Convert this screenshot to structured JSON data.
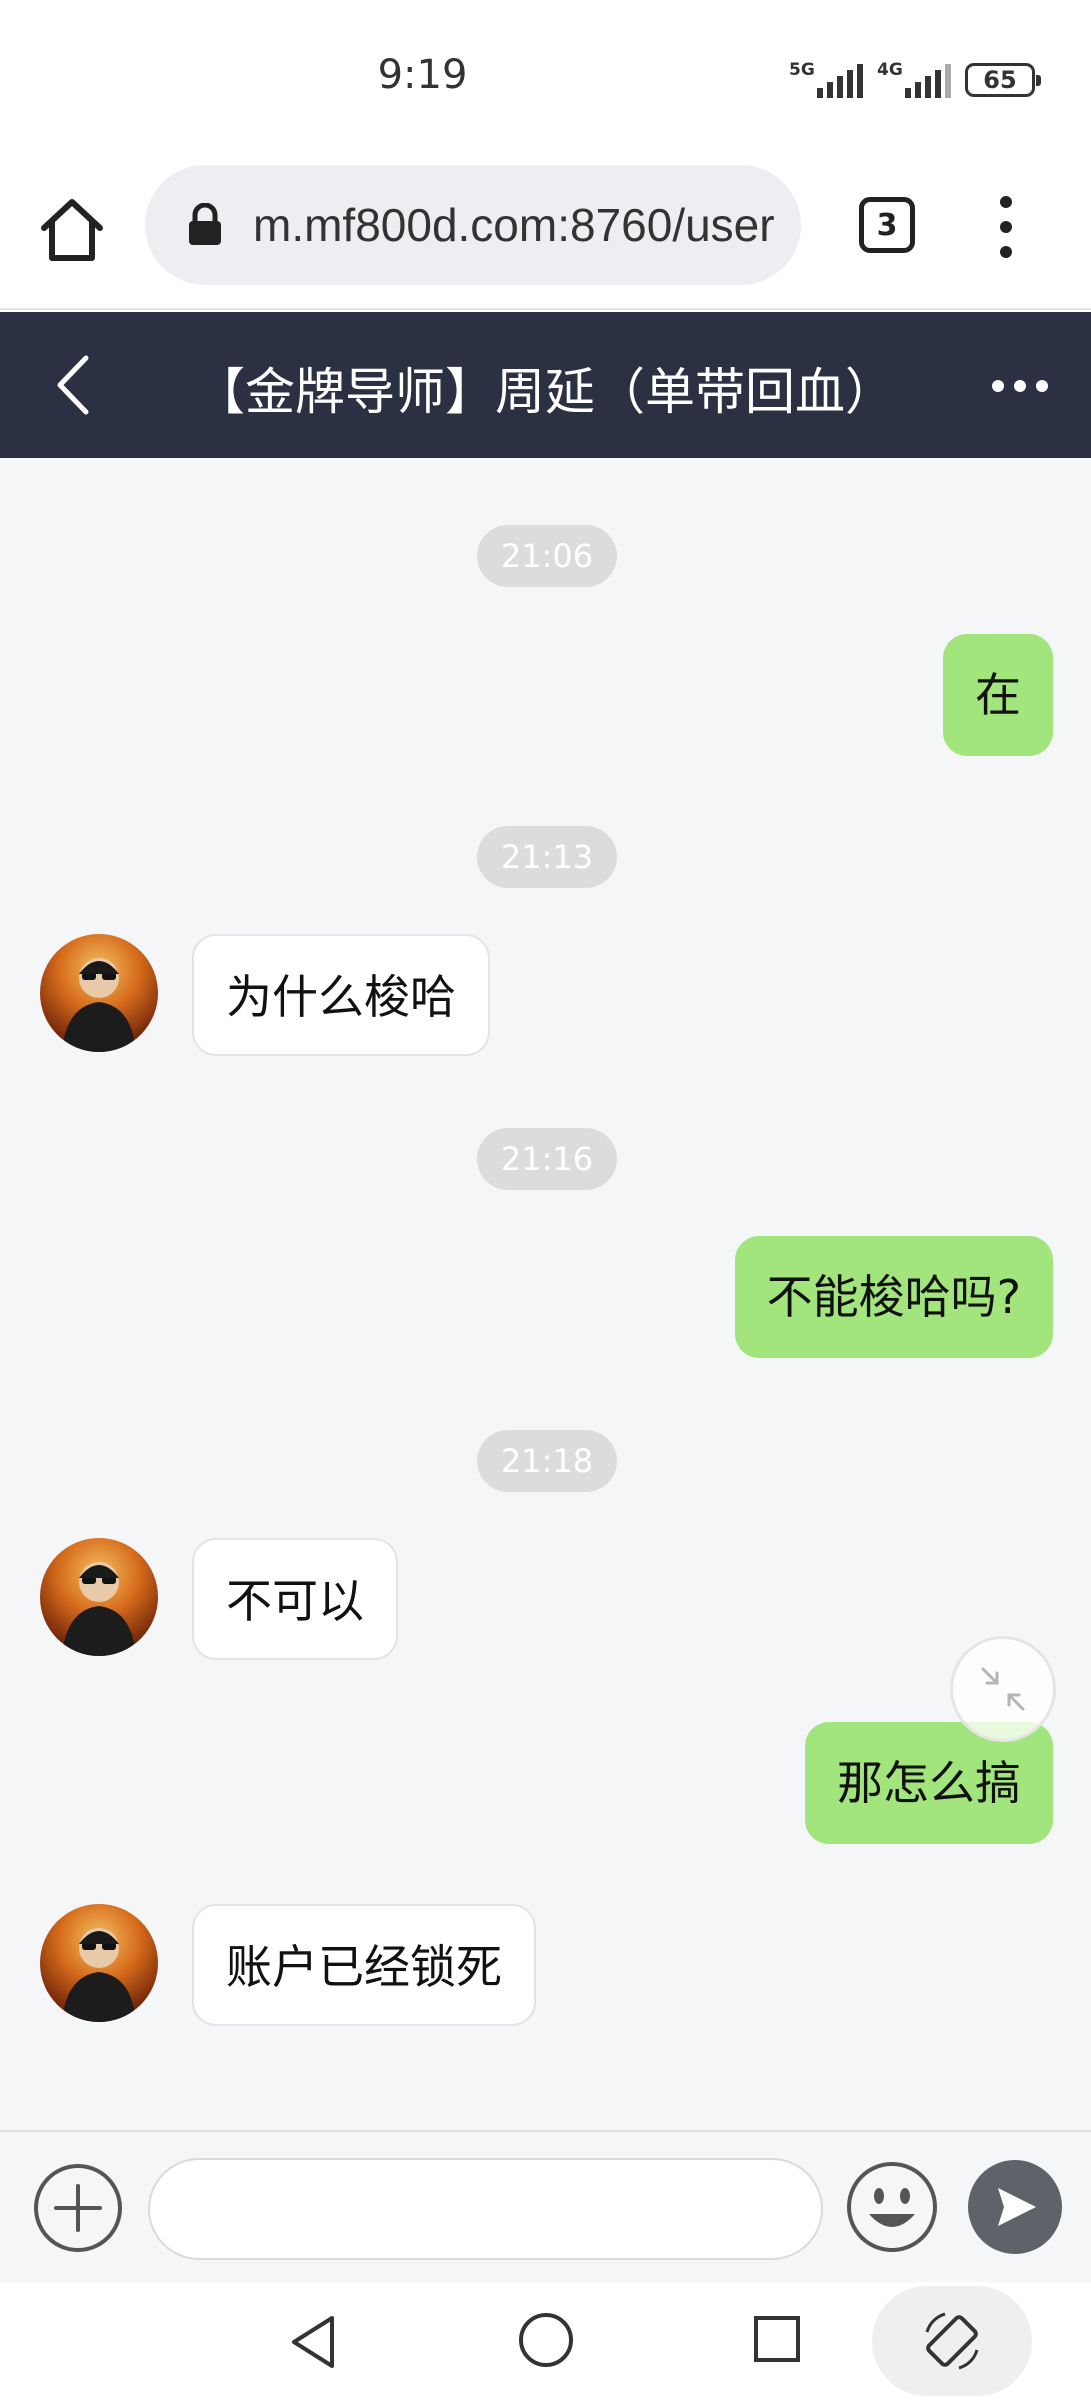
{
  "status_bar": {
    "time": "9:19",
    "network_1": "5G",
    "network_2": "4G",
    "battery": "65"
  },
  "browser": {
    "url": "m.mf800d.com:8760/user",
    "tab_count": "3"
  },
  "chat": {
    "title": "【金牌导师】周延（单带回血）",
    "messages": [
      {
        "type": "timestamp",
        "text": "21:06"
      },
      {
        "type": "sent",
        "text": "在"
      },
      {
        "type": "timestamp",
        "text": "21:13"
      },
      {
        "type": "received",
        "text": "为什么梭哈"
      },
      {
        "type": "timestamp",
        "text": "21:16"
      },
      {
        "type": "sent",
        "text": "不能梭哈吗?"
      },
      {
        "type": "timestamp",
        "text": "21:18"
      },
      {
        "type": "received",
        "text": "不可以"
      },
      {
        "type": "sent",
        "text": "那怎么搞"
      },
      {
        "type": "received",
        "text": "账户已经锁死"
      }
    ]
  },
  "input": {
    "value": "",
    "placeholder": ""
  },
  "icons": {
    "home": "home-icon",
    "lock": "lock-icon",
    "menu": "more-vertical-icon",
    "back": "chevron-left-icon",
    "more": "more-horizontal-icon",
    "plus": "plus-circle-icon",
    "emoji": "smiley-icon",
    "send": "send-icon",
    "minimize": "minimize-arrows-icon",
    "rotate": "screen-rotate-icon"
  },
  "colors": {
    "header_bg": "#2b3043",
    "sent_bubble": "#a2e57c",
    "received_bubble": "#ffffff",
    "chat_bg": "#f5f6f8"
  }
}
